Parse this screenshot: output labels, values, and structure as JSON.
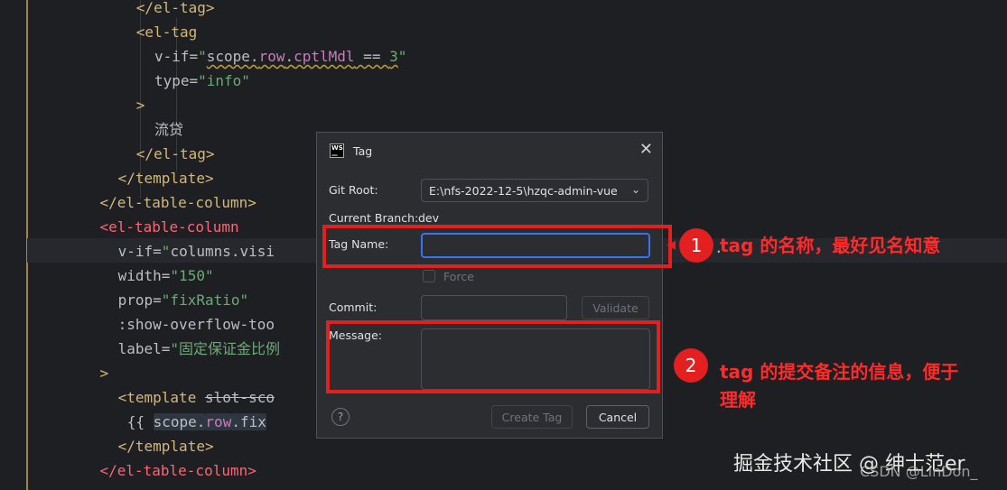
{
  "editor": {
    "lines": [
      {
        "indent": 11,
        "tokens": [
          {
            "c": "tk-tag",
            "t": "</el-tag>"
          }
        ]
      },
      {
        "indent": 11,
        "tokens": [
          {
            "c": "tk-tag",
            "t": "<el-tag"
          }
        ]
      },
      {
        "indent": 13,
        "tokens": [
          {
            "c": "tk-attr",
            "t": "v-if="
          },
          {
            "c": "tk-str",
            "t": "\""
          },
          {
            "c": "tk-plain squiggle",
            "t": "scope."
          },
          {
            "c": "tk-prop squiggle",
            "t": "row"
          },
          {
            "c": "tk-plain squiggle",
            "t": "."
          },
          {
            "c": "tk-prop squiggle",
            "t": "cptlMdl"
          },
          {
            "c": "tk-plain squiggle",
            "t": " == "
          },
          {
            "c": "tk-str squiggle",
            "t": "3"
          },
          {
            "c": "tk-str",
            "t": "\""
          }
        ]
      },
      {
        "indent": 13,
        "tokens": [
          {
            "c": "tk-attr",
            "t": "type="
          },
          {
            "c": "tk-str",
            "t": "\"info\""
          }
        ]
      },
      {
        "indent": 11,
        "tokens": [
          {
            "c": "tk-tag",
            "t": ">"
          }
        ]
      },
      {
        "indent": 13,
        "tokens": [
          {
            "c": "tk-plain",
            "t": "流贷"
          }
        ]
      },
      {
        "indent": 11,
        "tokens": [
          {
            "c": "tk-tag",
            "t": "</el-tag>"
          }
        ]
      },
      {
        "indent": 9,
        "tokens": [
          {
            "c": "tk-tag",
            "t": "</template>"
          }
        ]
      },
      {
        "indent": 7,
        "tokens": [
          {
            "c": "tk-tag",
            "t": "</el-table-column>"
          }
        ]
      },
      {
        "indent": 7,
        "tokens": [
          {
            "c": "tk-err",
            "t": "<el-table-column"
          }
        ]
      },
      {
        "indent": 9,
        "tokens": [
          {
            "c": "tk-attr",
            "t": "v-if="
          },
          {
            "c": "tk-str",
            "t": "\""
          },
          {
            "c": "tk-plain",
            "t": "columns.visi"
          }
        ]
      },
      {
        "indent": 9,
        "tokens": [
          {
            "c": "tk-attr",
            "t": "width="
          },
          {
            "c": "tk-str",
            "t": "\"150\""
          }
        ]
      },
      {
        "indent": 9,
        "tokens": [
          {
            "c": "tk-attr",
            "t": "prop="
          },
          {
            "c": "tk-str",
            "t": "\"fixRatio\""
          }
        ]
      },
      {
        "indent": 9,
        "tokens": [
          {
            "c": "tk-attr",
            "t": ":show-overflow-too"
          }
        ]
      },
      {
        "indent": 9,
        "tokens": [
          {
            "c": "tk-attr",
            "t": "label="
          },
          {
            "c": "tk-str",
            "t": "\"固定保证金比例"
          }
        ]
      },
      {
        "indent": 7,
        "tokens": [
          {
            "c": "tk-tag",
            "t": ">"
          }
        ]
      },
      {
        "indent": 9,
        "tokens": [
          {
            "c": "tk-tag",
            "t": "<template "
          },
          {
            "c": "tk-strike",
            "t": "slot-sco"
          }
        ]
      },
      {
        "indent": 10,
        "tokens": [
          {
            "c": "tk-plain",
            "t": "{{ "
          },
          {
            "c": "tk-plain tk-box",
            "t": "scope."
          },
          {
            "c": "tk-prop tk-box",
            "t": "row"
          },
          {
            "c": "tk-plain tk-box",
            "t": ".fix"
          }
        ]
      },
      {
        "indent": 9,
        "tokens": [
          {
            "c": "tk-tag",
            "t": "</template>"
          }
        ]
      },
      {
        "indent": 7,
        "tokens": [
          {
            "c": "tk-err",
            "t": "</el-table-column>"
          }
        ]
      }
    ]
  },
  "dialog": {
    "title": "Tag",
    "git_root_label": "Git Root:",
    "git_root_value": "E:\\nfs-2022-12-5\\hzqc-admin-vue",
    "current_branch_label": "Current Branch:",
    "current_branch_value": "dev",
    "tag_name_label": "Tag Name:",
    "tag_name_value": "",
    "force_label": "Force",
    "commit_label": "Commit:",
    "commit_value": "",
    "validate_label": "Validate",
    "message_label": "Message:",
    "message_value": "",
    "create_tag_label": "Create Tag",
    "cancel_label": "Cancel",
    "help_glyph": "?"
  },
  "annotations": {
    "circle1": "1",
    "note1": "tag 的名称，最好见名知意",
    "circle2": "2",
    "note2_line1": "tag 的提交备注的信息，便于",
    "note2_line2": "理解",
    "arrow_stub": "."
  },
  "watermark": {
    "main": "掘金技术社区 @ 绅士范er",
    "sub": "CSDN @LinDon_"
  },
  "colors": {
    "accent": "#3574f0",
    "annotation_red": "#e41f1f"
  }
}
